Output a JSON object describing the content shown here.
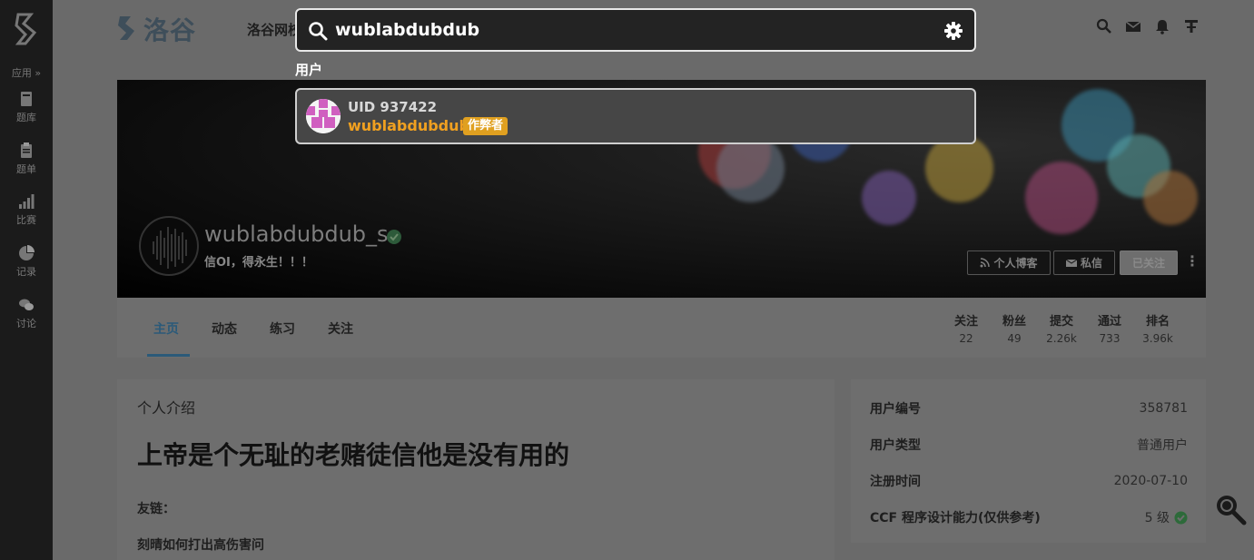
{
  "sidebar": {
    "apps_label": "应用 »",
    "items": [
      {
        "label": "题库",
        "icon": "book-icon"
      },
      {
        "label": "题单",
        "icon": "clipboard-icon"
      },
      {
        "label": "比赛",
        "icon": "bar-chart-icon"
      },
      {
        "label": "记录",
        "icon": "pie-chart-icon"
      },
      {
        "label": "讨论",
        "icon": "chat-icon"
      }
    ]
  },
  "header": {
    "logo_text": "洛谷",
    "nav_label": "洛谷网校"
  },
  "search": {
    "query": "wublabdubdub",
    "section_label": "用户",
    "result": {
      "uid": "UID 937422",
      "name": "wublabdubdub",
      "badge": "作弊者"
    }
  },
  "profile": {
    "username": "wublabdubdub_s",
    "slogan": "信OI，得永生！！！",
    "buttons": {
      "blog": "个人博客",
      "message": "私信",
      "follow": "已关注"
    }
  },
  "tabs": [
    "主页",
    "动态",
    "练习",
    "关注"
  ],
  "stats": [
    {
      "label": "关注",
      "value": "22"
    },
    {
      "label": "粉丝",
      "value": "49"
    },
    {
      "label": "提交",
      "value": "2.26k"
    },
    {
      "label": "通过",
      "value": "733"
    },
    {
      "label": "排名",
      "value": "3.96k"
    }
  ],
  "intro": {
    "title": "个人介绍",
    "heading": "上帝是个无耻的老赌徒信他是没有用的",
    "line1": "友链：",
    "line2": "刻晴如何打出高伤害问"
  },
  "info": [
    {
      "label": "用户编号",
      "value": "358781"
    },
    {
      "label": "用户类型",
      "value": "普通用户"
    },
    {
      "label": "注册时间",
      "value": "2020-07-10"
    },
    {
      "label": "CCF 程序设计能力(仅供参考)",
      "value": "5 级"
    }
  ],
  "colors": {
    "cheater_badge": "#e0a020",
    "link_orange": "#f0a020",
    "verify_green": "#3aa85c"
  }
}
